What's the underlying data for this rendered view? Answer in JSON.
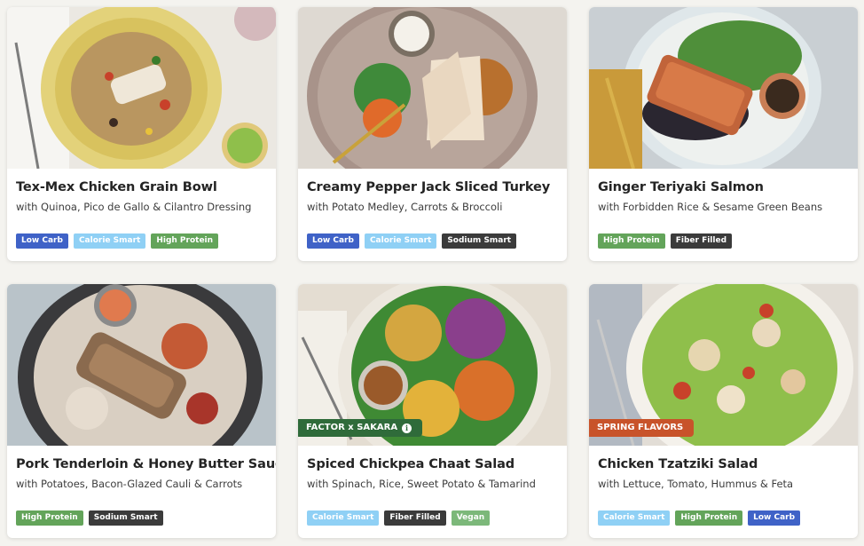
{
  "colors": {
    "low_carb": "#3f62c7",
    "calorie_smart": "#8fd0f5",
    "high_protein": "#63a45a",
    "sodium_smart": "#3b3b3b",
    "fiber_filled": "#3b3b3b",
    "vegan": "#7cb87a",
    "promo_green": "#2f6b3a",
    "promo_orange": "#c8532a"
  },
  "meals": [
    {
      "title": "Tex-Mex Chicken Grain Bowl",
      "subtitle": "with Quinoa, Pico de Gallo & Cilantro Dressing",
      "tags": [
        "Low Carb",
        "Calorie Smart",
        "High Protein"
      ]
    },
    {
      "title": "Creamy Pepper Jack Sliced Turkey",
      "subtitle": "with Potato Medley, Carrots & Broccoli",
      "tags": [
        "Low Carb",
        "Calorie Smart",
        "Sodium Smart"
      ]
    },
    {
      "title": "Ginger Teriyaki Salmon",
      "subtitle": "with Forbidden Rice & Sesame Green Beans",
      "tags": [
        "High Protein",
        "Fiber Filled"
      ]
    },
    {
      "title": "Pork Tenderloin & Honey Butter Sauce",
      "subtitle": "with Potatoes, Bacon-Glazed Cauli & Carrots",
      "tags": [
        "High Protein",
        "Sodium Smart"
      ]
    },
    {
      "title": "Spiced Chickpea Chaat Salad",
      "subtitle": "with Spinach, Rice, Sweet Potato & Tamarind",
      "tags": [
        "Calorie Smart",
        "Fiber Filled",
        "Vegan"
      ],
      "promo": "FACTOR x SAKARA"
    },
    {
      "title": "Chicken Tzatziki Salad",
      "subtitle": "with Lettuce, Tomato, Hummus & Feta",
      "tags": [
        "Calorie Smart",
        "High Protein",
        "Low Carb"
      ],
      "promo": "SPRING FLAVORS"
    }
  ]
}
